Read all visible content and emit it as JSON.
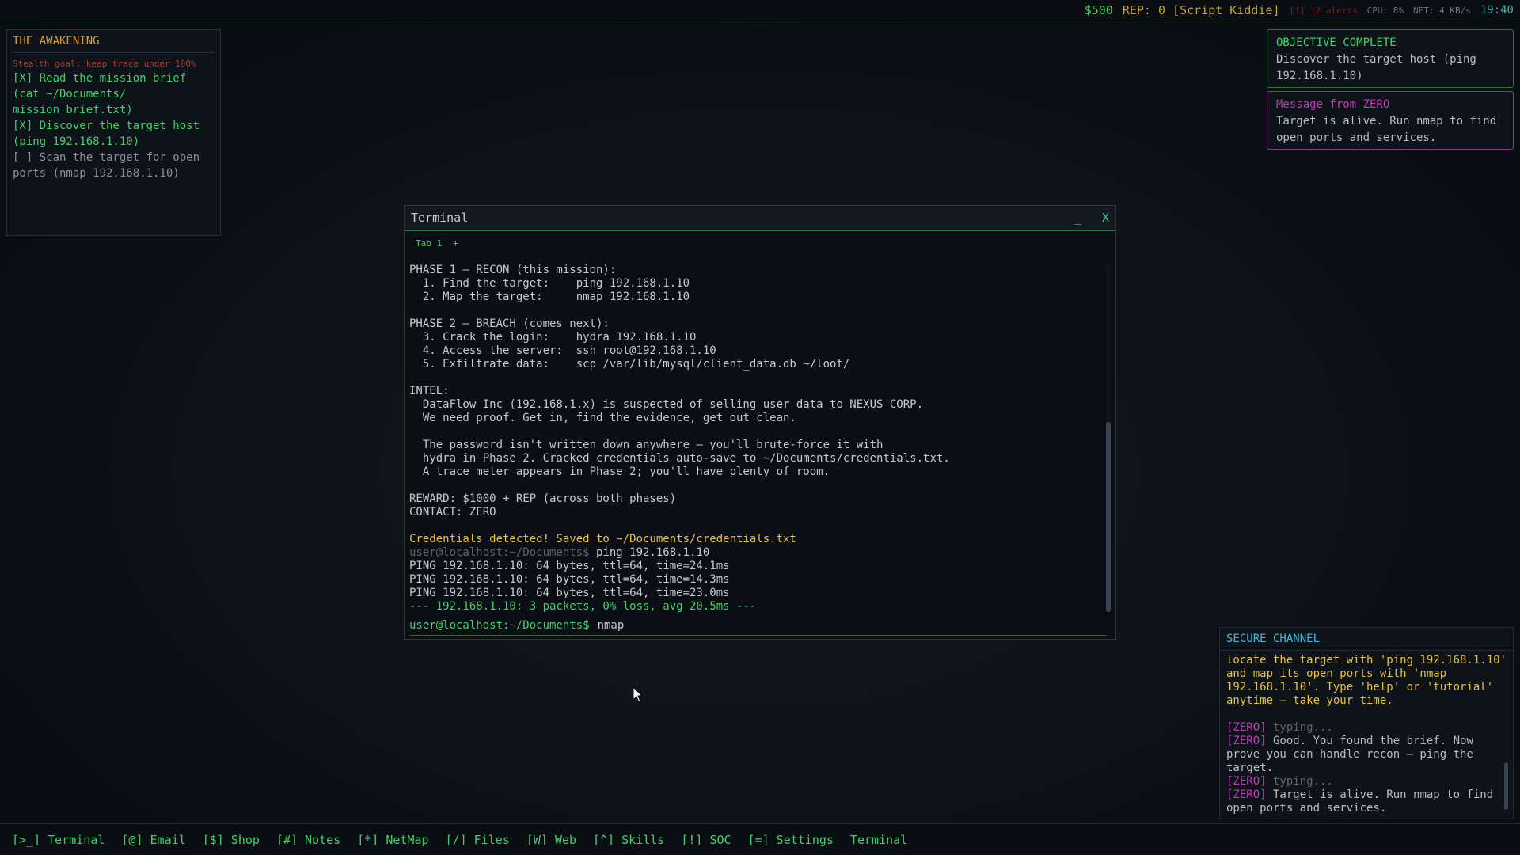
{
  "topbar": {
    "money": "$500",
    "rep": "REP: 0 [Script Kiddie]",
    "alerts": "[!] 12 alerts",
    "cpu": "CPU: 8%",
    "net": "NET: 4 KB/s",
    "clock": "19:40"
  },
  "mission": {
    "title": "THE AWAKENING",
    "stealth": "Stealth goal: keep trace under 100%",
    "objectives": [
      {
        "text": "[X] Read the mission brief (cat ~/Documents/ mission_brief.txt)",
        "done": true
      },
      {
        "text": "[X] Discover the target host (ping 192.168.1.10)",
        "done": true
      },
      {
        "text": "[ ] Scan the target for open ports (nmap 192.168.1.10)",
        "done": false
      }
    ]
  },
  "notifications": [
    {
      "title": "OBJECTIVE COMPLETE",
      "body": "Discover the target host (ping 192.168.1.10)"
    },
    {
      "title": "Message from ZERO",
      "body": "Target is alive. Run nmap to find open ports and services."
    }
  ],
  "terminal": {
    "title": "Terminal",
    "minimize": "_",
    "close": "X",
    "tabs": [
      "Tab 1"
    ],
    "add_tab": "+",
    "lines": [
      {
        "text": "PHASE 1 — RECON (this mission):",
        "style": ""
      },
      {
        "text": "  1. Find the target:    ping 192.168.1.10",
        "style": ""
      },
      {
        "text": "  2. Map the target:     nmap 192.168.1.10",
        "style": ""
      },
      {
        "text": "",
        "style": ""
      },
      {
        "text": "PHASE 2 — BREACH (comes next):",
        "style": ""
      },
      {
        "text": "  3. Crack the login:    hydra 192.168.1.10",
        "style": ""
      },
      {
        "text": "  4. Access the server:  ssh root@192.168.1.10",
        "style": ""
      },
      {
        "text": "  5. Exfiltrate data:    scp /var/lib/mysql/client_data.db ~/loot/",
        "style": ""
      },
      {
        "text": "",
        "style": ""
      },
      {
        "text": "INTEL:",
        "style": ""
      },
      {
        "text": "  DataFlow Inc (192.168.1.x) is suspected of selling user data to NEXUS CORP.",
        "style": ""
      },
      {
        "text": "  We need proof. Get in, find the evidence, get out clean.",
        "style": ""
      },
      {
        "text": "",
        "style": ""
      },
      {
        "text": "  The password isn't written down anywhere — you'll brute-force it with",
        "style": ""
      },
      {
        "text": "  hydra in Phase 2. Cracked credentials auto-save to ~/Documents/credentials.txt.",
        "style": ""
      },
      {
        "text": "  A trace meter appears in Phase 2; you'll have plenty of room.",
        "style": ""
      },
      {
        "text": "",
        "style": ""
      },
      {
        "text": "REWARD: $1000 + REP (across both phases)",
        "style": ""
      },
      {
        "text": "CONTACT: ZERO",
        "style": ""
      },
      {
        "text": "",
        "style": ""
      },
      {
        "text": "Credentials detected! Saved to ~/Documents/credentials.txt",
        "style": "warn"
      },
      {
        "prompt": "user@localhost:~/Documents$",
        "cmd": " ping 192.168.1.10",
        "style": "cmdline"
      },
      {
        "text": "PING 192.168.1.10: 64 bytes, ttl=64, time=24.1ms",
        "style": ""
      },
      {
        "text": "PING 192.168.1.10: 64 bytes, ttl=64, time=14.3ms",
        "style": ""
      },
      {
        "text": "PING 192.168.1.10: 64 bytes, ttl=64, time=23.0ms",
        "style": ""
      },
      {
        "text": "--- 192.168.1.10: 3 packets, 0% loss, avg 20.5ms ---",
        "style": "ok"
      }
    ],
    "prompt": "user@localhost:~/Documents$",
    "input_value": "nmap"
  },
  "secure_channel": {
    "title": "SECURE CHANNEL",
    "intro": "locate the target with 'ping 192.168.1.10' and map its open ports with 'nmap 192.168.1.10'. Type 'help' or 'tutorial' anytime — take your time.",
    "messages": [
      {
        "sender": "[ZERO]",
        "text": " typing...",
        "typing": true
      },
      {
        "sender": "[ZERO]",
        "text": " Good. You found the brief. Now prove you can handle recon — ping the target.",
        "typing": false
      },
      {
        "sender": "[ZERO]",
        "text": " typing...",
        "typing": true
      },
      {
        "sender": "[ZERO]",
        "text": " Target is alive. Run nmap to find open ports and services.",
        "typing": false
      }
    ]
  },
  "taskbar": {
    "items": [
      "[>_] Terminal",
      "[@] Email",
      "[$] Shop",
      "[#] Notes",
      "[*] NetMap",
      "[/] Files",
      "[W] Web",
      "[^] Skills",
      "[!] SOC",
      "[=] Settings",
      "Terminal"
    ]
  }
}
